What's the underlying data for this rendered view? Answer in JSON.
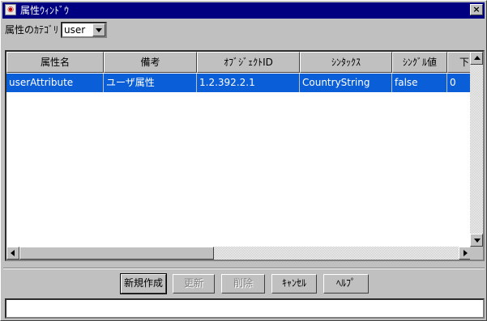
{
  "window": {
    "title": "属性ｳｨﾝﾄﾞｳ",
    "close_label": "×"
  },
  "category": {
    "label": "属性のｶﾃｺﾞﾘ",
    "value": "user"
  },
  "table": {
    "columns": [
      "属性名",
      "備考",
      "ｵﾌﾞｼﾞｪｸﾄID",
      "ｼﾝﾀｯｸｽ",
      "ｼﾝｸﾞﾙ値",
      "下"
    ],
    "rows": [
      [
        "userAttribute",
        "ユーザ属性",
        "1.2.392.2.1",
        "CountryString",
        "false",
        "0"
      ]
    ],
    "selected_row": 0
  },
  "buttons": {
    "create": "新規作成",
    "update": "更新",
    "delete": "削除",
    "cancel": "ｷｬﾝｾﾙ",
    "help": "ﾍﾙﾌﾟ"
  },
  "status": {
    "text": ""
  },
  "colors": {
    "titlebar": "#000080",
    "selection": "#0a5ed7",
    "face": "#c0c0c0"
  }
}
